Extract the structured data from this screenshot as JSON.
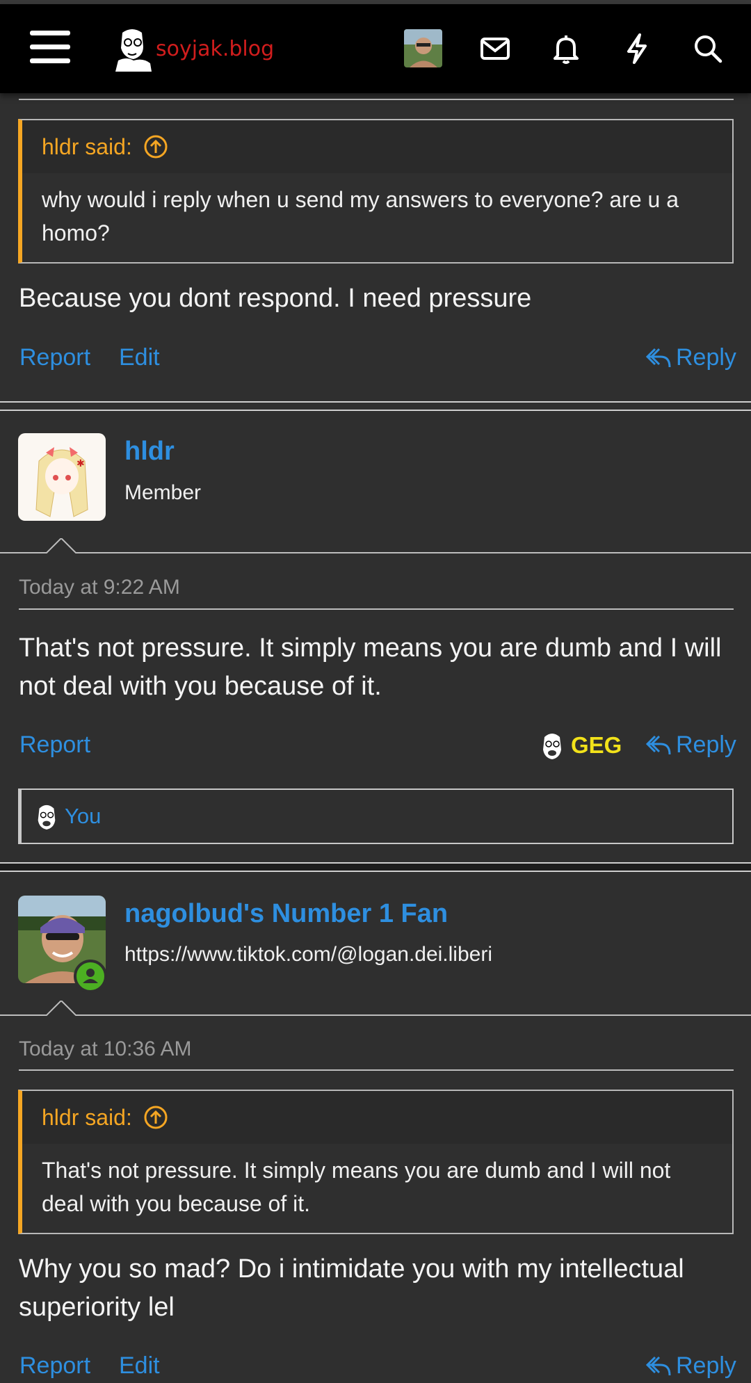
{
  "header": {
    "site_name": "soyjak.blog",
    "icons": [
      "menu-icon",
      "logo",
      "avatar",
      "envelope-icon",
      "bell-icon",
      "bolt-icon",
      "search-icon"
    ]
  },
  "posts": [
    {
      "quote": {
        "author_said": "hldr said:",
        "text": "why would i reply when u send my answers to everyone? are u a homo?"
      },
      "message": "Because you dont respond. I need pressure",
      "actions": {
        "report": "Report",
        "edit": "Edit",
        "reply": "Reply"
      }
    },
    {
      "username": "hldr",
      "user_title": "Member",
      "time": "Today at 9:22 AM",
      "message": "That's not pressure. It simply means you are dumb and I will not deal with you because of it.",
      "actions": {
        "report": "Report",
        "reply": "Reply"
      },
      "reaction_label": "GEG",
      "reacted_by": "You"
    },
    {
      "username": "nagolbud's Number 1 Fan",
      "user_title": "https://www.tiktok.com/@logan.dei.liberi",
      "time": "Today at 10:36 AM",
      "quote": {
        "author_said": "hldr said:",
        "text": "That's not pressure. It simply means you are dumb and I will not deal with you because of it."
      },
      "message": "Why you so mad? Do i intimidate you with my intellectual superiority lel",
      "actions": {
        "report": "Report",
        "edit": "Edit",
        "reply": "Reply"
      }
    }
  ],
  "colors": {
    "link": "#2e8fe0",
    "quote_accent": "#f5a623",
    "reaction": "#f2e21a",
    "logo": "#d11d1d",
    "online": "#4caf22"
  }
}
